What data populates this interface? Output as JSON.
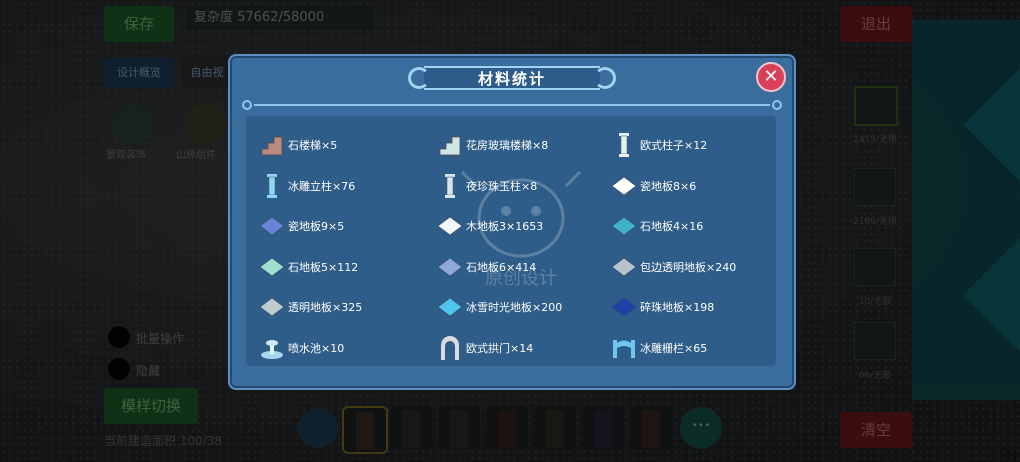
{
  "background": {
    "save_button": "保存",
    "complexity": "复杂度 57662/58000",
    "design_button": "设计概览",
    "free_button": "自由视",
    "exit_button": "退出",
    "clear_button": "清空",
    "category_labels": [
      "景观装饰",
      "山脉组件"
    ],
    "radio_options": [
      "批量操作",
      "隐藏"
    ],
    "switch_button": "模样切换",
    "status_text": "当前建造面积 100/38",
    "side_counts": [
      "1419/无限",
      "2189/无限",
      "10/无限",
      "66/无限"
    ],
    "more_icon": "···"
  },
  "modal": {
    "title": "材料统计",
    "close_icon": "✕",
    "watermark_text": "原创设计",
    "materials": [
      {
        "label": "石楼梯×5",
        "icon": "stairs-icon",
        "color": "#b88a80"
      },
      {
        "label": "花房玻璃楼梯×8",
        "icon": "glass-stairs-icon",
        "color": "#cfe6e8"
      },
      {
        "label": "欧式柱子×12",
        "icon": "pillar-icon",
        "color": "#e8eef0"
      },
      {
        "label": "冰雕立柱×76",
        "icon": "ice-pillar-icon",
        "color": "#8fd6f2"
      },
      {
        "label": "夜珍珠玉柱×8",
        "icon": "pearl-pillar-icon",
        "color": "#d8e4ea"
      },
      {
        "label": "瓷地板8×6",
        "icon": "floor-tile-icon",
        "color": "#ffffff"
      },
      {
        "label": "瓷地板9×5",
        "icon": "floor-tile-icon",
        "color": "#6c82d8"
      },
      {
        "label": "木地板3×1653",
        "icon": "floor-tile-icon",
        "color": "#f4f8fb"
      },
      {
        "label": "石地板4×16",
        "icon": "floor-tile-icon",
        "color": "#3fb0c8"
      },
      {
        "label": "石地板5×112",
        "icon": "floor-tile-icon",
        "color": "#9fe0d0"
      },
      {
        "label": "石地板6×414",
        "icon": "floor-tile-icon",
        "color": "#8fa8d8"
      },
      {
        "label": "包边透明地板×240",
        "icon": "floor-tile-icon",
        "color": "#b8c4cc"
      },
      {
        "label": "透明地板×325",
        "icon": "floor-tile-icon",
        "color": "#c0cad0"
      },
      {
        "label": "冰雪时光地板×200",
        "icon": "floor-tile-icon",
        "color": "#4fc4ec"
      },
      {
        "label": "碎珠地板×198",
        "icon": "floor-tile-icon",
        "color": "#2040a8"
      },
      {
        "label": "喷水池×10",
        "icon": "fountain-icon",
        "color": "#a8d8f0"
      },
      {
        "label": "欧式拱门×14",
        "icon": "arch-door-icon",
        "color": "#d8dce0"
      },
      {
        "label": "冰雕栅栏×65",
        "icon": "ice-fence-icon",
        "color": "#6ec8f0"
      }
    ]
  }
}
